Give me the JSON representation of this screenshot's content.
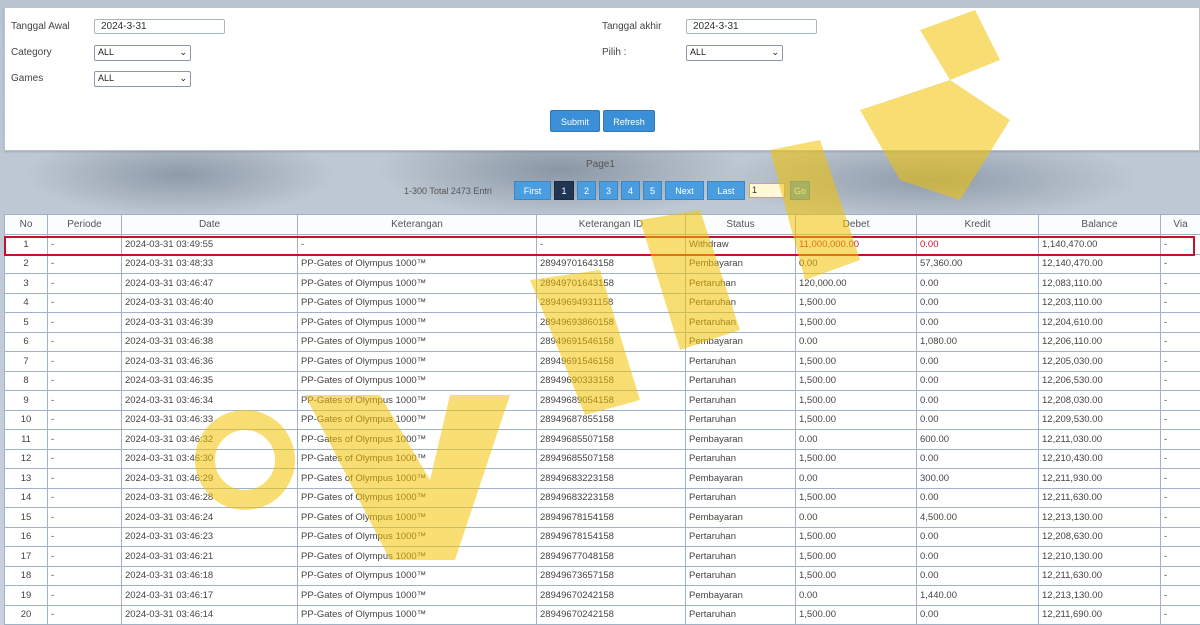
{
  "filters": {
    "start_date_label": "Tanggal Awal",
    "start_date_value": "2024-3-31",
    "end_date_label": "Tanggal akhir",
    "end_date_value": "2024-3-31",
    "category_label": "Category",
    "category_value": "ALL",
    "pilih_label": "Pilih  :",
    "pilih_value": "ALL",
    "games_label": "Games",
    "games_value": "ALL",
    "submit_label": "Submit",
    "refresh_label": "Refresh"
  },
  "pagination": {
    "page_label": "Page1",
    "total_text": "1-300 Total 2473 Entri",
    "first": "First",
    "pages": [
      "1",
      "2",
      "3",
      "4",
      "5"
    ],
    "next": "Next",
    "last": "Last",
    "page_input": "1",
    "go": "Go"
  },
  "table": {
    "headers": [
      "No",
      "Periode",
      "Date",
      "Keterangan",
      "Keterangan ID",
      "Status",
      "Debet",
      "Kredit",
      "Balance",
      "Via"
    ],
    "rows": [
      [
        "1",
        "-",
        "2024-03-31 03:49:55",
        "-",
        "-",
        "Withdraw",
        "11,000,000.00",
        "0.00",
        "1,140,470.00",
        "-"
      ],
      [
        "2",
        "-",
        "2024-03-31 03:48:33",
        "PP-Gates of Olympus 1000™",
        "28949701643158",
        "Pembayaran",
        "0.00",
        "57,360.00",
        "12,140,470.00",
        "-"
      ],
      [
        "3",
        "-",
        "2024-03-31 03:46:47",
        "PP-Gates of Olympus 1000™",
        "28949701643158",
        "Pertaruhan",
        "120,000.00",
        "0.00",
        "12,083,110.00",
        "-"
      ],
      [
        "4",
        "-",
        "2024-03-31 03:46:40",
        "PP-Gates of Olympus 1000™",
        "28949694931158",
        "Pertaruhan",
        "1,500.00",
        "0.00",
        "12,203,110.00",
        "-"
      ],
      [
        "5",
        "-",
        "2024-03-31 03:46:39",
        "PP-Gates of Olympus 1000™",
        "28949693860158",
        "Pertaruhan",
        "1,500.00",
        "0.00",
        "12,204,610.00",
        "-"
      ],
      [
        "6",
        "-",
        "2024-03-31 03:46:38",
        "PP-Gates of Olympus 1000™",
        "28949691546158",
        "Pembayaran",
        "0.00",
        "1,080.00",
        "12,206,110.00",
        "-"
      ],
      [
        "7",
        "-",
        "2024-03-31 03:46:36",
        "PP-Gates of Olympus 1000™",
        "28949691546158",
        "Pertaruhan",
        "1,500.00",
        "0.00",
        "12,205,030.00",
        "-"
      ],
      [
        "8",
        "-",
        "2024-03-31 03:46:35",
        "PP-Gates of Olympus 1000™",
        "28949690333158",
        "Pertaruhan",
        "1,500.00",
        "0.00",
        "12,206,530.00",
        "-"
      ],
      [
        "9",
        "-",
        "2024-03-31 03:46:34",
        "PP-Gates of Olympus 1000™",
        "28949689054158",
        "Pertaruhan",
        "1,500.00",
        "0.00",
        "12,208,030.00",
        "-"
      ],
      [
        "10",
        "-",
        "2024-03-31 03:46:33",
        "PP-Gates of Olympus 1000™",
        "28949687855158",
        "Pertaruhan",
        "1,500.00",
        "0.00",
        "12,209,530.00",
        "-"
      ],
      [
        "11",
        "-",
        "2024-03-31 03:46:32",
        "PP-Gates of Olympus 1000™",
        "28949685507158",
        "Pembayaran",
        "0.00",
        "600.00",
        "12,211,030.00",
        "-"
      ],
      [
        "12",
        "-",
        "2024-03-31 03:46:30",
        "PP-Gates of Olympus 1000™",
        "28949685507158",
        "Pertaruhan",
        "1,500.00",
        "0.00",
        "12,210,430.00",
        "-"
      ],
      [
        "13",
        "-",
        "2024-03-31 03:46:29",
        "PP-Gates of Olympus 1000™",
        "28949683223158",
        "Pembayaran",
        "0.00",
        "300.00",
        "12,211,930.00",
        "-"
      ],
      [
        "14",
        "-",
        "2024-03-31 03:46:28",
        "PP-Gates of Olympus 1000™",
        "28949683223158",
        "Pertaruhan",
        "1,500.00",
        "0.00",
        "12,211,630.00",
        "-"
      ],
      [
        "15",
        "-",
        "2024-03-31 03:46:24",
        "PP-Gates of Olympus 1000™",
        "28949678154158",
        "Pembayaran",
        "0.00",
        "4,500.00",
        "12,213,130.00",
        "-"
      ],
      [
        "16",
        "-",
        "2024-03-31 03:46:23",
        "PP-Gates of Olympus 1000™",
        "28949678154158",
        "Pertaruhan",
        "1,500.00",
        "0.00",
        "12,208,630.00",
        "-"
      ],
      [
        "17",
        "-",
        "2024-03-31 03:46:21",
        "PP-Gates of Olympus 1000™",
        "28949677048158",
        "Pertaruhan",
        "1,500.00",
        "0.00",
        "12,210,130.00",
        "-"
      ],
      [
        "18",
        "-",
        "2024-03-31 03:46:18",
        "PP-Gates of Olympus 1000™",
        "28949673657158",
        "Pertaruhan",
        "1,500.00",
        "0.00",
        "12,211,630.00",
        "-"
      ],
      [
        "19",
        "-",
        "2024-03-31 03:46:17",
        "PP-Gates of Olympus 1000™",
        "28949670242158",
        "Pembayaran",
        "0.00",
        "1,440.00",
        "12,213,130.00",
        "-"
      ],
      [
        "20",
        "-",
        "2024-03-31 03:46:14",
        "PP-Gates of Olympus 1000™",
        "28949670242158",
        "Pertaruhan",
        "1,500.00",
        "0.00",
        "12,211,690.00",
        "-"
      ]
    ]
  },
  "colors": {
    "accent_blue": "#3a8fd6",
    "highlight_red": "#c8102e",
    "watermark_yellow": "#f2c200"
  }
}
